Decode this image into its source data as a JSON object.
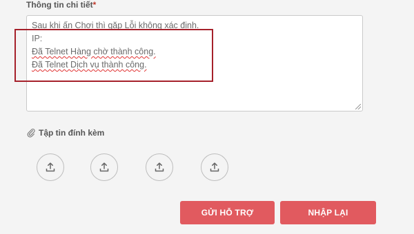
{
  "form": {
    "detail_label": "Thông tin chi tiết",
    "required_mark": "*",
    "detail_lines": [
      "Sau khi ấn Chơi thì gặp Lỗi không xác định.",
      "IP:",
      "Đã Telnet Hàng chờ thành công.",
      "Đã Telnet Dịch vụ thành công."
    ],
    "attachment_label": "Tập tin đính kèm",
    "upload_icons": [
      "upload-icon",
      "upload-icon",
      "upload-icon",
      "upload-icon"
    ],
    "submit_label": "GỬI HỖ TRỢ",
    "reset_label": "NHẬP LẠI"
  },
  "colors": {
    "button_bg": "#e15a5f",
    "highlight_border": "#a5202a",
    "required": "#c0392b"
  }
}
